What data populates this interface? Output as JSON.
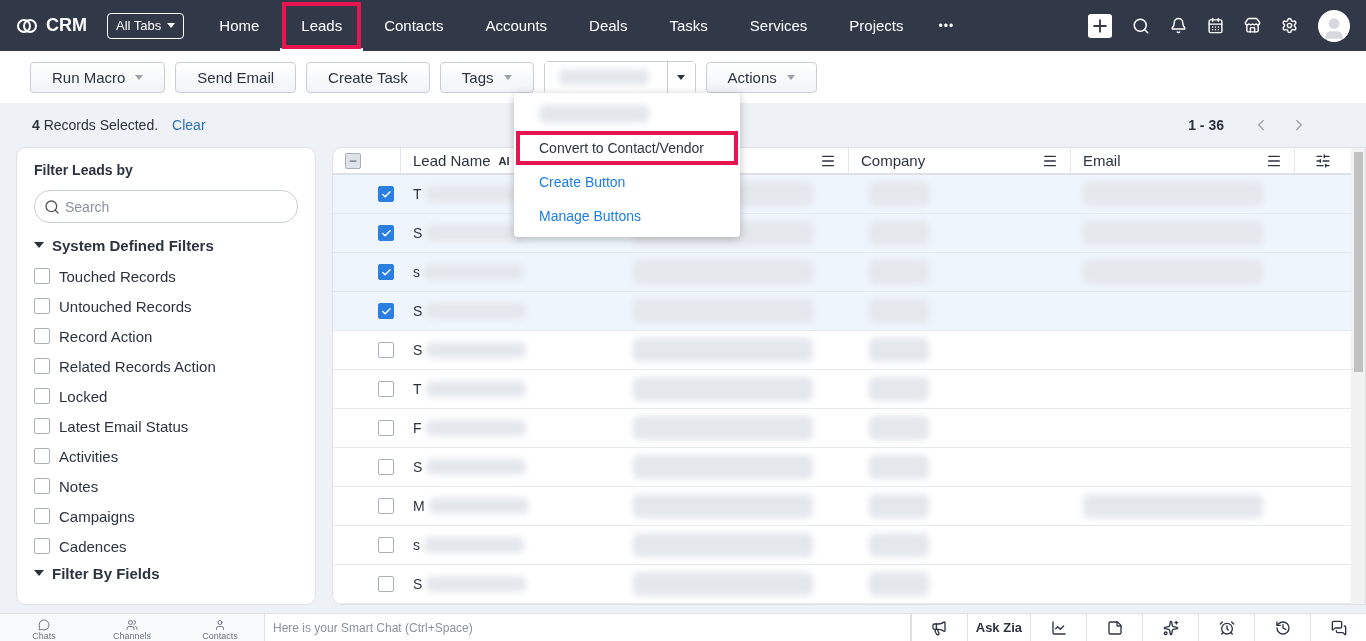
{
  "topbar": {
    "brand": "CRM",
    "all_tabs": "All Tabs",
    "more": "•••",
    "tabs": [
      {
        "label": "Home",
        "selected": false,
        "highlighted": false
      },
      {
        "label": "Leads",
        "selected": true,
        "highlighted": true
      },
      {
        "label": "Contacts",
        "selected": false,
        "highlighted": false
      },
      {
        "label": "Accounts",
        "selected": false,
        "highlighted": false
      },
      {
        "label": "Deals",
        "selected": false,
        "highlighted": false
      },
      {
        "label": "Tasks",
        "selected": false,
        "highlighted": false
      },
      {
        "label": "Services",
        "selected": false,
        "highlighted": false
      },
      {
        "label": "Projects",
        "selected": false,
        "highlighted": false
      }
    ]
  },
  "toolbar": {
    "buttons": [
      {
        "label": "Run Macro",
        "kind": "dropdown"
      },
      {
        "label": "Send Email",
        "kind": "plain"
      },
      {
        "label": "Create Task",
        "kind": "plain"
      },
      {
        "label": "Tags",
        "kind": "dropdown"
      },
      {
        "kind": "split"
      },
      {
        "label": "Actions",
        "kind": "dropdown"
      }
    ],
    "menu": {
      "items": [
        {
          "kind": "blurred",
          "highlighted": false
        },
        {
          "kind": "action",
          "label": "Convert to Contact/Vendor",
          "highlighted": true
        },
        {
          "kind": "link",
          "label": "Create Button",
          "highlighted": false
        },
        {
          "kind": "link",
          "label": "Manage Buttons",
          "highlighted": false
        }
      ]
    }
  },
  "selection": {
    "text": "**4** Records Selected.",
    "clear": "Clear",
    "range": "1 - 36"
  },
  "filters": {
    "title": "Filter Leads by",
    "search": {
      "placeholder": "Search"
    },
    "sections": [
      {
        "title": "System Defined Filters",
        "expanded": true,
        "items": [
          {
            "label": "Touched Records",
            "checked": false
          },
          {
            "label": "Untouched Records",
            "checked": false
          },
          {
            "label": "Record Action",
            "checked": false
          },
          {
            "label": "Related Records Action",
            "checked": false
          },
          {
            "label": "Locked",
            "checked": false
          },
          {
            "label": "Latest Email Status",
            "checked": false
          },
          {
            "label": "Activities",
            "checked": false
          },
          {
            "label": "Notes",
            "checked": false
          },
          {
            "label": "Campaigns",
            "checked": false
          },
          {
            "label": "Cadences",
            "checked": false
          }
        ]
      },
      {
        "title": "Filter By Fields",
        "expanded": true
      }
    ]
  },
  "table": {
    "select_all_indeterminate": true,
    "columns": [
      "Lead Name",
      "Company",
      "Email"
    ],
    "lead_name_tag": "Al",
    "rows": [
      {
        "lead_name": "T",
        "selected": true,
        "email_blurred": true
      },
      {
        "lead_name": "S",
        "selected": true,
        "email_blurred": true
      },
      {
        "lead_name": "s",
        "selected": true,
        "email_blurred": true
      },
      {
        "lead_name": "S",
        "selected": true,
        "email_blurred": false
      },
      {
        "lead_name": "S",
        "selected": false,
        "email_blurred": false
      },
      {
        "lead_name": "T",
        "selected": false,
        "email_blurred": false
      },
      {
        "lead_name": "F",
        "selected": false,
        "email_blurred": false
      },
      {
        "lead_name": "S",
        "selected": false,
        "email_blurred": false
      },
      {
        "lead_name": "M",
        "selected": false,
        "email_blurred": true
      },
      {
        "lead_name": "s",
        "selected": false,
        "email_blurred": false
      },
      {
        "lead_name": "S",
        "selected": false,
        "email_blurred": false
      }
    ]
  },
  "bottom_bar": {
    "apps": [
      {
        "label": "Chats",
        "kind": "chats"
      },
      {
        "label": "Channels",
        "kind": "channels"
      },
      {
        "label": "Contacts",
        "kind": "contacts"
      }
    ],
    "chat": {
      "placeholder": "Here is your Smart Chat (Ctrl+Space)"
    },
    "tools": [
      {
        "kind": "megaphone"
      },
      {
        "kind": "text",
        "label": "Ask Zia"
      },
      {
        "kind": "chart"
      },
      {
        "kind": "note"
      },
      {
        "kind": "zia"
      },
      {
        "kind": "alarm"
      },
      {
        "kind": "history"
      },
      {
        "kind": "messages"
      }
    ]
  }
}
